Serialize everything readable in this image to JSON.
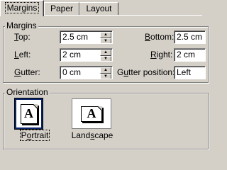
{
  "tabs": [
    {
      "label": "Margins",
      "active": true
    },
    {
      "label": "Paper",
      "active": false
    },
    {
      "label": "Layout",
      "active": false
    }
  ],
  "margins": {
    "legend": "Margins",
    "top": {
      "prefix": "",
      "ul": "T",
      "rest": "op:",
      "value": "2.5 cm"
    },
    "bottom": {
      "prefix": "",
      "ul": "B",
      "rest": "ottom:",
      "value": "2.5 cm"
    },
    "left": {
      "prefix": "",
      "ul": "L",
      "rest": "eft:",
      "value": "2 cm"
    },
    "right": {
      "prefix": "",
      "ul": "R",
      "rest": "ight:",
      "value": "2 cm"
    },
    "gutter": {
      "prefix": "",
      "ul": "G",
      "rest": "utter:",
      "value": "0 cm"
    },
    "gutter_position": {
      "prefix": "G",
      "ul": "u",
      "rest": "tter position:",
      "value": "Left"
    }
  },
  "orientation": {
    "legend": "Orientation",
    "portrait": {
      "glyph": "A",
      "prefix": "P",
      "ul": "o",
      "rest": "rtrait",
      "selected": true
    },
    "landscape": {
      "glyph": "A",
      "prefix": "Land",
      "ul": "s",
      "rest": "cape",
      "selected": false
    }
  },
  "icons": {
    "spin_up": "▲",
    "spin_down": "▼"
  }
}
